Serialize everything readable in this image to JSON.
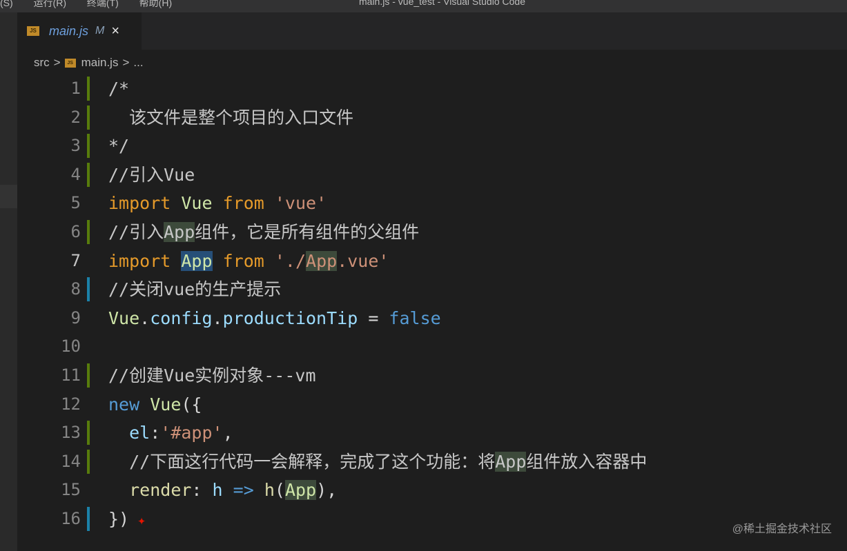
{
  "titlebar": {
    "menus": [
      "(S)",
      "运行(R)",
      "终端(T)",
      "帮助(H)"
    ],
    "window_title": "main.js - vue_test - Visual Studio Code"
  },
  "tab": {
    "icon_text": "JS",
    "name": "main.js",
    "modified": "M",
    "close": "×"
  },
  "breadcrumb": {
    "folder": "src",
    "sep": ">",
    "file": "main.js",
    "tail": "..."
  },
  "editor": {
    "active_line": 7,
    "lines": [
      {
        "n": "1",
        "gutter": "green",
        "tokens": [
          {
            "c": "tk-comment",
            "t": "/*"
          }
        ]
      },
      {
        "n": "2",
        "gutter": "green",
        "tokens": [
          {
            "c": "tk-comment",
            "t": "  该文件是整个项目的入口文件"
          }
        ]
      },
      {
        "n": "3",
        "gutter": "green",
        "tokens": [
          {
            "c": "tk-comment",
            "t": "*/"
          }
        ]
      },
      {
        "n": "4",
        "gutter": "green",
        "tokens": [
          {
            "c": "tk-comment",
            "t": "//引入Vue"
          }
        ]
      },
      {
        "n": "5",
        "gutter": "",
        "tokens": [
          {
            "c": "tk-kw",
            "t": "import"
          },
          {
            "c": "tk-op",
            "t": " "
          },
          {
            "c": "tk-var",
            "t": "Vue"
          },
          {
            "c": "tk-op",
            "t": " "
          },
          {
            "c": "tk-kw",
            "t": "from"
          },
          {
            "c": "tk-op",
            "t": " "
          },
          {
            "c": "tk-str",
            "t": "'vue'"
          }
        ]
      },
      {
        "n": "6",
        "gutter": "green",
        "tokens": [
          {
            "c": "tk-comment",
            "t": "//引入"
          },
          {
            "c": "tk-comment hl2",
            "t": "App"
          },
          {
            "c": "tk-comment",
            "t": "组件，它是所有组件的父组件"
          }
        ]
      },
      {
        "n": "7",
        "gutter": "",
        "tokens": [
          {
            "c": "tk-kw",
            "t": "import"
          },
          {
            "c": "tk-op",
            "t": " "
          },
          {
            "c": "tk-var hl",
            "t": "App"
          },
          {
            "c": "tk-op",
            "t": " "
          },
          {
            "c": "tk-kw",
            "t": "from"
          },
          {
            "c": "tk-op",
            "t": " "
          },
          {
            "c": "tk-str",
            "t": "'./"
          },
          {
            "c": "tk-str hl2",
            "t": "App"
          },
          {
            "c": "tk-str",
            "t": ".vue'"
          }
        ]
      },
      {
        "n": "8",
        "gutter": "blue",
        "tokens": [
          {
            "c": "tk-comment",
            "t": "//关闭vue的生产提示"
          }
        ]
      },
      {
        "n": "9",
        "gutter": "",
        "tokens": [
          {
            "c": "tk-var",
            "t": "Vue"
          },
          {
            "c": "tk-op",
            "t": "."
          },
          {
            "c": "tk-id",
            "t": "config"
          },
          {
            "c": "tk-op",
            "t": "."
          },
          {
            "c": "tk-id",
            "t": "productionTip"
          },
          {
            "c": "tk-op",
            "t": " = "
          },
          {
            "c": "tk-kw2",
            "t": "false"
          }
        ]
      },
      {
        "n": "10",
        "gutter": "",
        "tokens": []
      },
      {
        "n": "11",
        "gutter": "green",
        "tokens": [
          {
            "c": "tk-comment",
            "t": "//创建Vue实例对象---vm"
          }
        ]
      },
      {
        "n": "12",
        "gutter": "",
        "tokens": [
          {
            "c": "tk-kw2",
            "t": "new"
          },
          {
            "c": "tk-op",
            "t": " "
          },
          {
            "c": "tk-var",
            "t": "Vue"
          },
          {
            "c": "tk-op",
            "t": "({"
          }
        ]
      },
      {
        "n": "13",
        "gutter": "green",
        "tokens": [
          {
            "c": "tk-op",
            "t": "  "
          },
          {
            "c": "tk-id",
            "t": "el"
          },
          {
            "c": "tk-op",
            "t": ":"
          },
          {
            "c": "tk-str",
            "t": "'#app'"
          },
          {
            "c": "tk-op",
            "t": ","
          }
        ]
      },
      {
        "n": "14",
        "gutter": "green",
        "tokens": [
          {
            "c": "tk-comment",
            "t": "  //下面这行代码一会解释，完成了这个功能：将"
          },
          {
            "c": "tk-comment hl2",
            "t": "App"
          },
          {
            "c": "tk-comment",
            "t": "组件放入容器中"
          }
        ]
      },
      {
        "n": "15",
        "gutter": "",
        "tokens": [
          {
            "c": "tk-op",
            "t": "  "
          },
          {
            "c": "tk-fn",
            "t": "render"
          },
          {
            "c": "tk-op",
            "t": ": "
          },
          {
            "c": "tk-id",
            "t": "h"
          },
          {
            "c": "tk-op",
            "t": " "
          },
          {
            "c": "tk-kw2",
            "t": "=>"
          },
          {
            "c": "tk-op",
            "t": " "
          },
          {
            "c": "tk-fn",
            "t": "h"
          },
          {
            "c": "tk-op",
            "t": "("
          },
          {
            "c": "tk-var hl2",
            "t": "App"
          },
          {
            "c": "tk-op",
            "t": "),"
          }
        ]
      },
      {
        "n": "16",
        "gutter": "blue",
        "tokens": [
          {
            "c": "tk-op",
            "t": "})"
          }
        ]
      }
    ]
  },
  "watermark": "@稀土掘金技术社区",
  "colors": {
    "background": "#1e1e1e",
    "keyword": "#e59a2a",
    "gutter_added": "#587c0c",
    "gutter_modified": "#1b81a8"
  }
}
